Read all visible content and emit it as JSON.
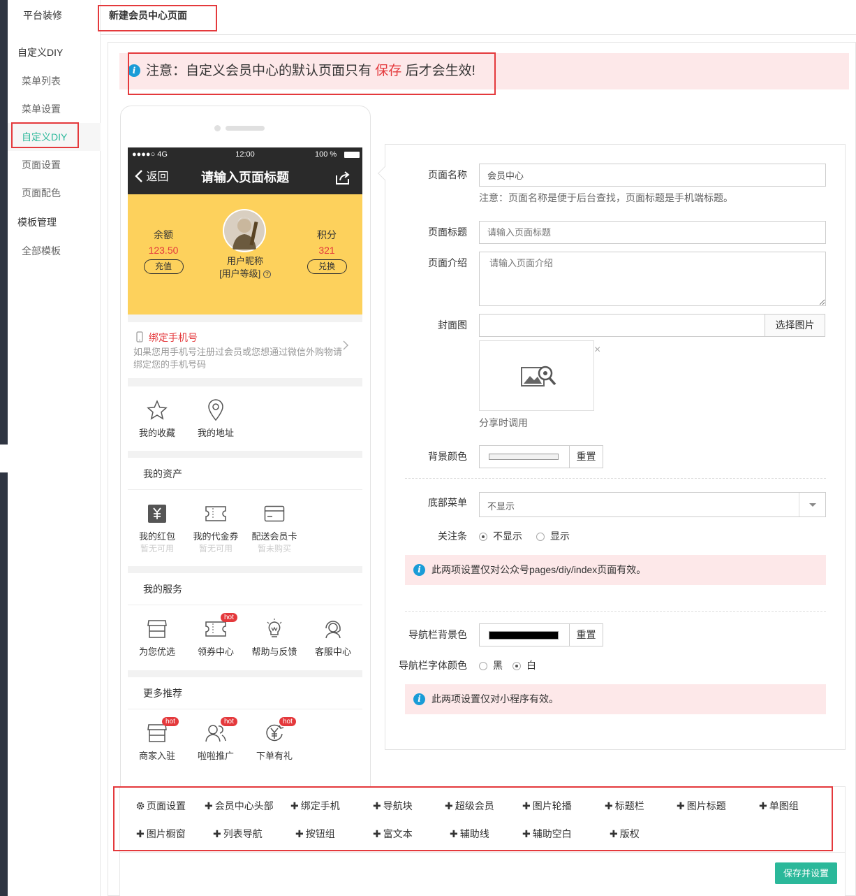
{
  "sidebar": {
    "title": "平台装修",
    "groups": [
      {
        "label": "自定义DIY",
        "items": [
          "菜单列表",
          "菜单设置",
          "自定义DIY",
          "页面设置",
          "页面配色"
        ]
      },
      {
        "label": "模板管理",
        "items": [
          "全部模板"
        ]
      }
    ],
    "active": "自定义DIY"
  },
  "topbar": {
    "tab": "新建会员中心页面"
  },
  "notice": {
    "before": "注意：自定义会员中心的默认页面只有",
    "highlight": "保存",
    "after": "后才会生效!"
  },
  "phone": {
    "status": {
      "signal": "●●●●○ 4G",
      "time": "12:00",
      "battery": "100 %"
    },
    "nav": {
      "back": "返回",
      "title": "请输入页面标题"
    },
    "head": {
      "balance_label": "余额",
      "balance": "123.50",
      "recharge": "充值",
      "nickname": "用户昵称",
      "level": "[用户等级]",
      "points_label": "积分",
      "points": "321",
      "exchange": "兑换"
    },
    "bind": {
      "title": "绑定手机号",
      "desc": "如果您用手机号注册过会员或您想通过微信外购物请绑定您的手机号码"
    },
    "quick": [
      {
        "label": "我的收藏"
      },
      {
        "label": "我的地址"
      }
    ],
    "assets": {
      "title": "我的资产",
      "items": [
        {
          "label": "我的红包",
          "sub": "暂无可用"
        },
        {
          "label": "我的代金券",
          "sub": "暂无可用"
        },
        {
          "label": "配送会员卡",
          "sub": "暂未购买"
        }
      ]
    },
    "services": {
      "title": "我的服务",
      "items": [
        {
          "label": "为您优选"
        },
        {
          "label": "领券中心",
          "hot": "hot"
        },
        {
          "label": "帮助与反馈"
        },
        {
          "label": "客服中心"
        }
      ]
    },
    "more": {
      "title": "更多推荐",
      "items": [
        {
          "label": "商家入驻",
          "hot": "hot"
        },
        {
          "label": "啦啦推广",
          "hot": "hot"
        },
        {
          "label": "下单有礼",
          "hot": "hot"
        }
      ]
    }
  },
  "form": {
    "page_name": {
      "label": "页面名称",
      "value": "会员中心",
      "hint": "注意：页面名称是便于后台查找，页面标题是手机端标题。"
    },
    "page_title": {
      "label": "页面标题",
      "placeholder": "请输入页面标题"
    },
    "page_intro": {
      "label": "页面介绍",
      "placeholder": "请输入页面介绍"
    },
    "cover": {
      "label": "封面图",
      "button": "选择图片",
      "caption": "分享时调用",
      "remove": "×"
    },
    "bg_color": {
      "label": "背景颜色",
      "color": "#f2f2f2",
      "reset": "重置"
    },
    "bottom_menu": {
      "label": "底部菜单",
      "value": "不显示"
    },
    "follow_bar": {
      "label": "关注条",
      "options": [
        "不显示",
        "显示"
      ],
      "selected": "不显示"
    },
    "tip1": "此两项设置仅对公众号pages/diy/index页面有效。",
    "nav_bg": {
      "label": "导航栏背景色",
      "color": "#000000",
      "reset": "重置"
    },
    "nav_font": {
      "label": "导航栏字体颜色",
      "options": [
        "黑",
        "白"
      ],
      "selected": "白"
    },
    "tip2": "此两项设置仅对小程序有效。"
  },
  "toolbar": {
    "row1": [
      "页面设置",
      "会员中心头部",
      "绑定手机",
      "导航块",
      "超级会员",
      "图片轮播",
      "标题栏",
      "图片标题",
      "单图组"
    ],
    "row2": [
      "图片橱窗",
      "列表导航",
      "按钮组",
      "富文本",
      "辅助线",
      "辅助空白",
      "版权"
    ]
  },
  "save_button": "保存并设置",
  "colors": {
    "accent": "#2bb89a",
    "danger": "#e4393c",
    "header_yellow": "#fdd15c",
    "info": "#1a9cd7"
  }
}
